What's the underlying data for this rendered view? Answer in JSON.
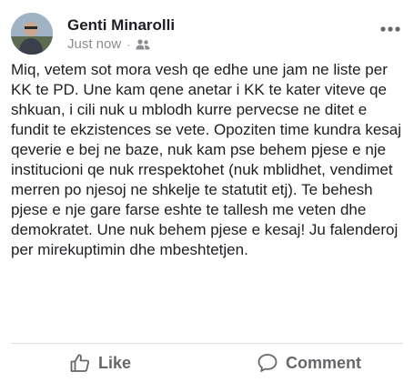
{
  "post": {
    "author": "Genti Minarolli",
    "timestamp": "Just now",
    "separator": "·",
    "audience_icon": "friends-icon",
    "more_icon": "more-options-icon",
    "text": "Miq, vetem sot mora vesh qe edhe une jam ne liste per KK te PD. Une kam qene anetar i KK te kater viteve qe shkuan, i cili nuk u mblodh kurre pervecse ne ditet e fundit te ekzistences se vete. Opoziten time kundra kesaj qeverie e bej ne baze, nuk kam pse behem pjese e nje institucioni qe nuk rrespektohet (nuk mblidhet, vendimet merren po njesoj ne shkelje te statutit etj). Te behesh pjese e nje gare farse eshte te tallesh me veten dhe demokratet. Une nuk behem pjese e kesaj! Ju falenderoj per mirekuptimin dhe mbeshtetjen."
  },
  "actions": {
    "like_label": "Like",
    "like_icon": "thumbs-up-icon",
    "comment_label": "Comment",
    "comment_icon": "comment-bubble-icon"
  },
  "colors": {
    "text": "#1c1e21",
    "secondary": "#8a8d91",
    "action": "#65676b",
    "divider": "#dadde1"
  }
}
